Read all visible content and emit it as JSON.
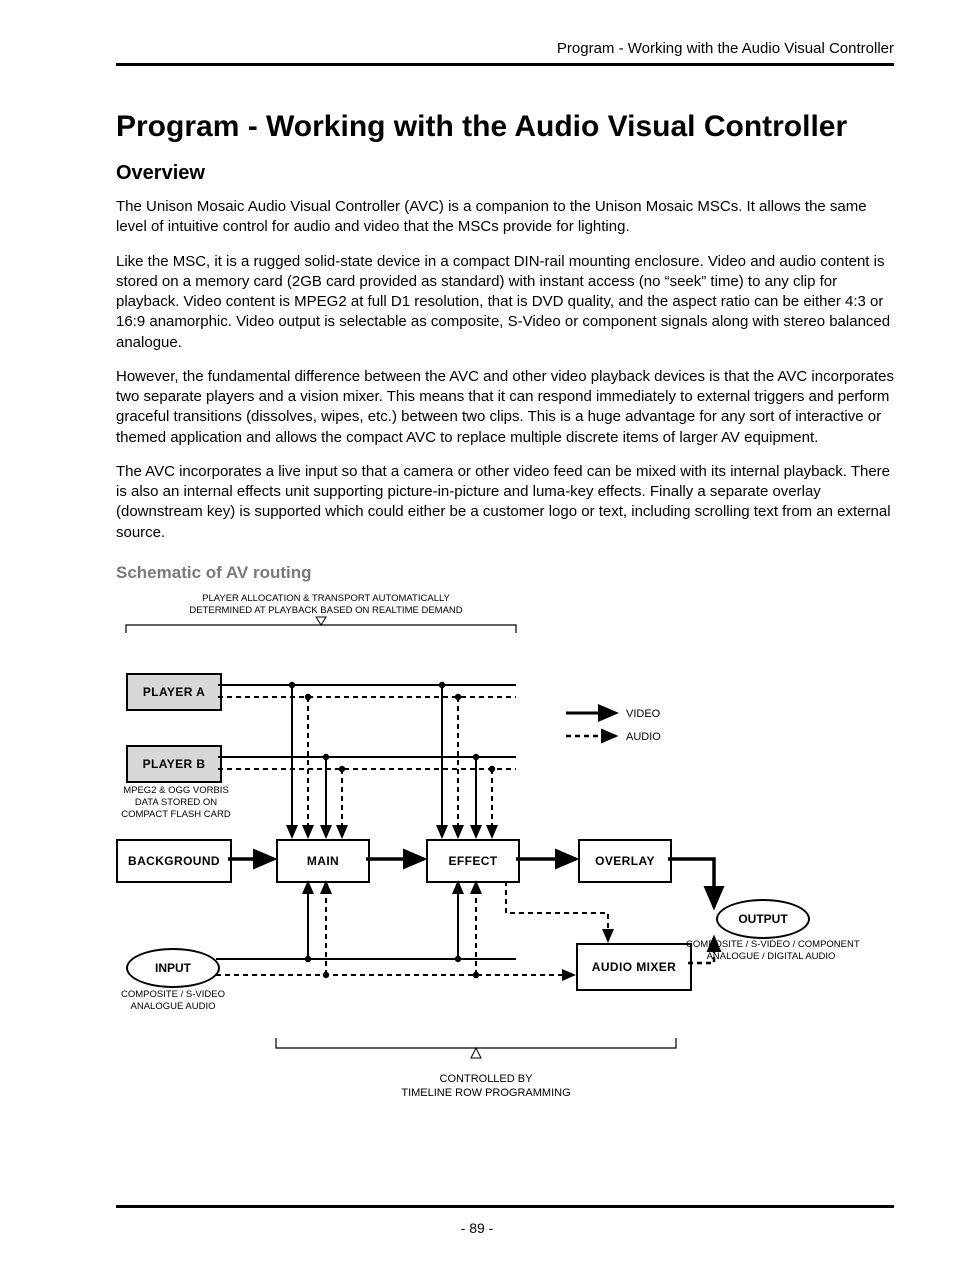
{
  "header": {
    "running": "Program - Working with the Audio Visual Controller"
  },
  "title": "Program - Working with the Audio Visual Controller",
  "sections": {
    "overview_h": "Overview",
    "p1": "The Unison Mosaic Audio Visual Controller (AVC) is a companion to the Unison Mosaic MSCs. It allows the same level of intuitive control for audio and video that the MSCs provide for lighting.",
    "p2": "Like the MSC, it is a rugged solid-state device in a compact DIN-rail mounting enclosure. Video and audio content is stored on a memory card (2GB card provided as standard) with instant access (no “seek” time) to any clip for playback. Video content is MPEG2 at full D1 resolution, that is DVD quality, and the aspect ratio can be either 4:3 or 16:9 anamorphic. Video output is selectable as composite, S-Video or component signals along with stereo balanced analogue.",
    "p3": "However, the fundamental difference between the AVC and other video playback devices is that the AVC incorporates two separate players and a vision mixer. This means that it can respond immediately to external triggers and perform graceful transitions (dissolves, wipes, etc.) between two clips. This is a huge advantage for any sort of interactive or themed application and allows the compact AVC to replace multiple discrete items of larger AV equipment.",
    "p4": "The AVC incorporates a live input so that a camera or other video feed can be mixed with its internal playback. There is also an internal effects unit supporting picture-in-picture and luma-key effects. Finally a separate overlay (downstream key) is supported which could either be a customer logo or text, including scrolling text from an external source.",
    "schematic_h": "Schematic of AV routing"
  },
  "diagram": {
    "top_caption": "PLAYER ALLOCATION & TRANSPORT AUTOMATICALLY\nDETERMINED AT PLAYBACK BASED ON REALTIME DEMAND",
    "player_a": "PLAYER A",
    "player_b": "PLAYER B",
    "storage_note": "MPEG2 & OGG VORBIS\nDATA STORED ON\nCOMPACT FLASH CARD",
    "background": "BACKGROUND",
    "main": "MAIN",
    "effect": "EFFECT",
    "overlay": "OVERLAY",
    "input": "INPUT",
    "input_note": "COMPOSITE / S-VIDEO\nANALOGUE AUDIO",
    "audio_mixer": "AUDIO MIXER",
    "output": "OUTPUT",
    "output_note": "COMPOSITE / S-VIDEO / COMPONENT\nANALOGUE / DIGITAL AUDIO",
    "legend_video": "VIDEO",
    "legend_audio": "AUDIO",
    "bottom_caption": "CONTROLLED BY\nTIMELINE ROW PROGRAMMING"
  },
  "footer": {
    "page_no": "- 89 -"
  }
}
